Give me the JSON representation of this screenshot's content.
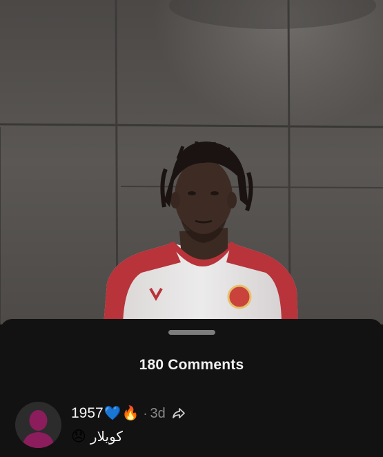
{
  "video": {
    "subject": "football player in white and red jersey"
  },
  "sheet": {
    "comments_count_label": "180 Comments"
  },
  "comments": [
    {
      "username": "1957",
      "username_emojis": [
        "💙",
        "🔥"
      ],
      "separator": "·",
      "timestamp": "3d",
      "body": "كويلار",
      "body_emoji": "😞",
      "avatar_icon": "default-avatar-icon",
      "share_icon": "share-icon"
    }
  ],
  "colors": {
    "sheet_background": "#121212",
    "avatar_accent": "#8b1d5c",
    "text_primary": "#f4f4f4",
    "text_secondary": "#8a8a8a"
  }
}
